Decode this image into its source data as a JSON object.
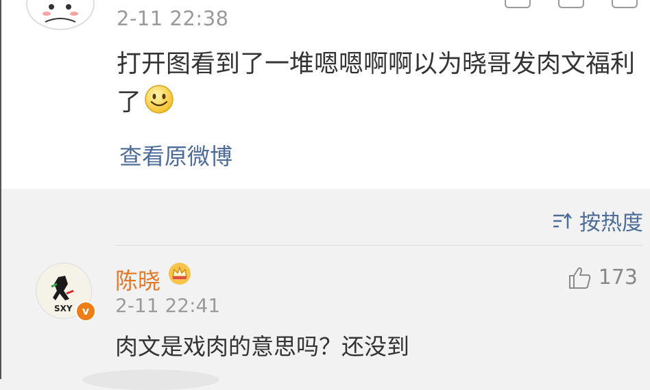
{
  "post": {
    "date": "2-11 22:38",
    "text": "打开图看到了一堆嗯嗯啊啊以为晓哥发肉文福利了",
    "view_original": "查看原微博"
  },
  "sort": {
    "label": "按热度"
  },
  "comment": {
    "username": "陈晓",
    "date": "2-11 22:41",
    "text": "肉文是戏肉的意思吗？还没到",
    "like_count": "173",
    "avatar_text": "SXY",
    "verified_badge": "v"
  },
  "colors": {
    "link": "#4e6c9a",
    "username": "#e07a2c",
    "badge": "#f07c16"
  }
}
